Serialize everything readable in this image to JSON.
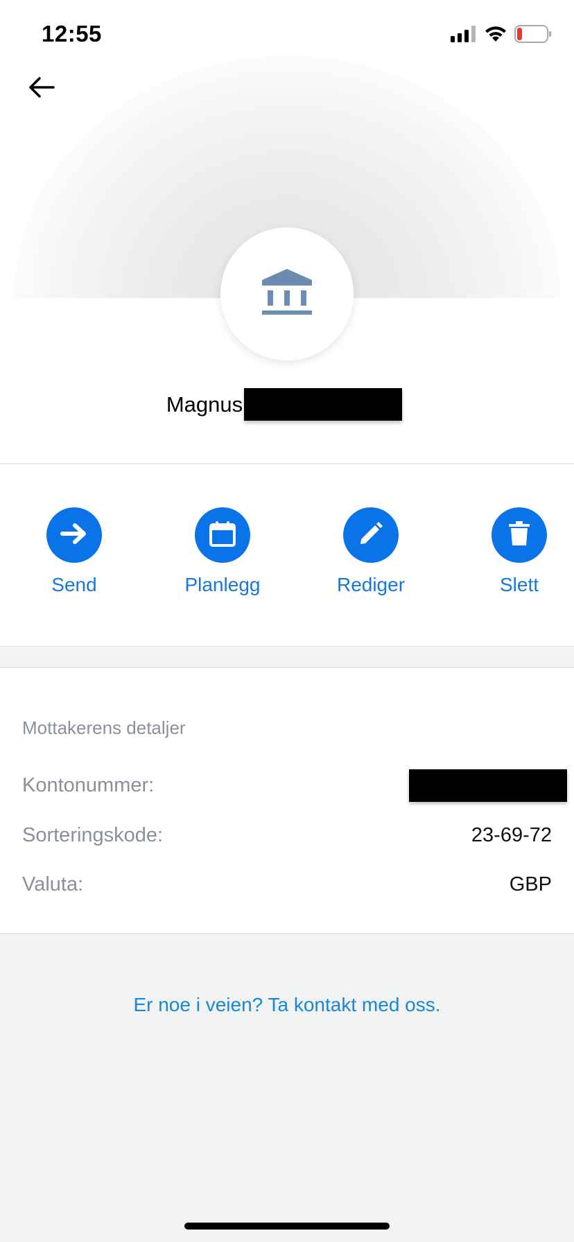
{
  "status_bar": {
    "time": "12:55",
    "icons": [
      "signal-icon",
      "wifi-icon",
      "battery-low-icon"
    ]
  },
  "header": {
    "back_icon": "arrow-left-icon"
  },
  "recipient": {
    "avatar_icon": "bank-icon",
    "first_name": "Magnus",
    "last_name_redacted": true
  },
  "actions": [
    {
      "label": "Send",
      "icon": "arrow-right-icon"
    },
    {
      "label": "Planlegg",
      "icon": "calendar-icon"
    },
    {
      "label": "Rediger",
      "icon": "pencil-icon"
    },
    {
      "label": "Slett",
      "icon": "trash-icon"
    }
  ],
  "details": {
    "title": "Mottakerens detaljer",
    "rows": [
      {
        "label": "Kontonummer:",
        "value": "",
        "redacted": true
      },
      {
        "label": "Sorteringskode:",
        "value": "23-69-72"
      },
      {
        "label": "Valuta:",
        "value": "GBP"
      }
    ]
  },
  "footer": {
    "contact_text": "Er noe i veien? Ta kontakt med oss."
  },
  "colors": {
    "accent": "#0a73e8",
    "action_text": "#1677e0",
    "link": "#1a86d6",
    "muted_text": "#8a9099",
    "bank_icon": "#6b8cb0",
    "battery_low": "#e53935"
  }
}
